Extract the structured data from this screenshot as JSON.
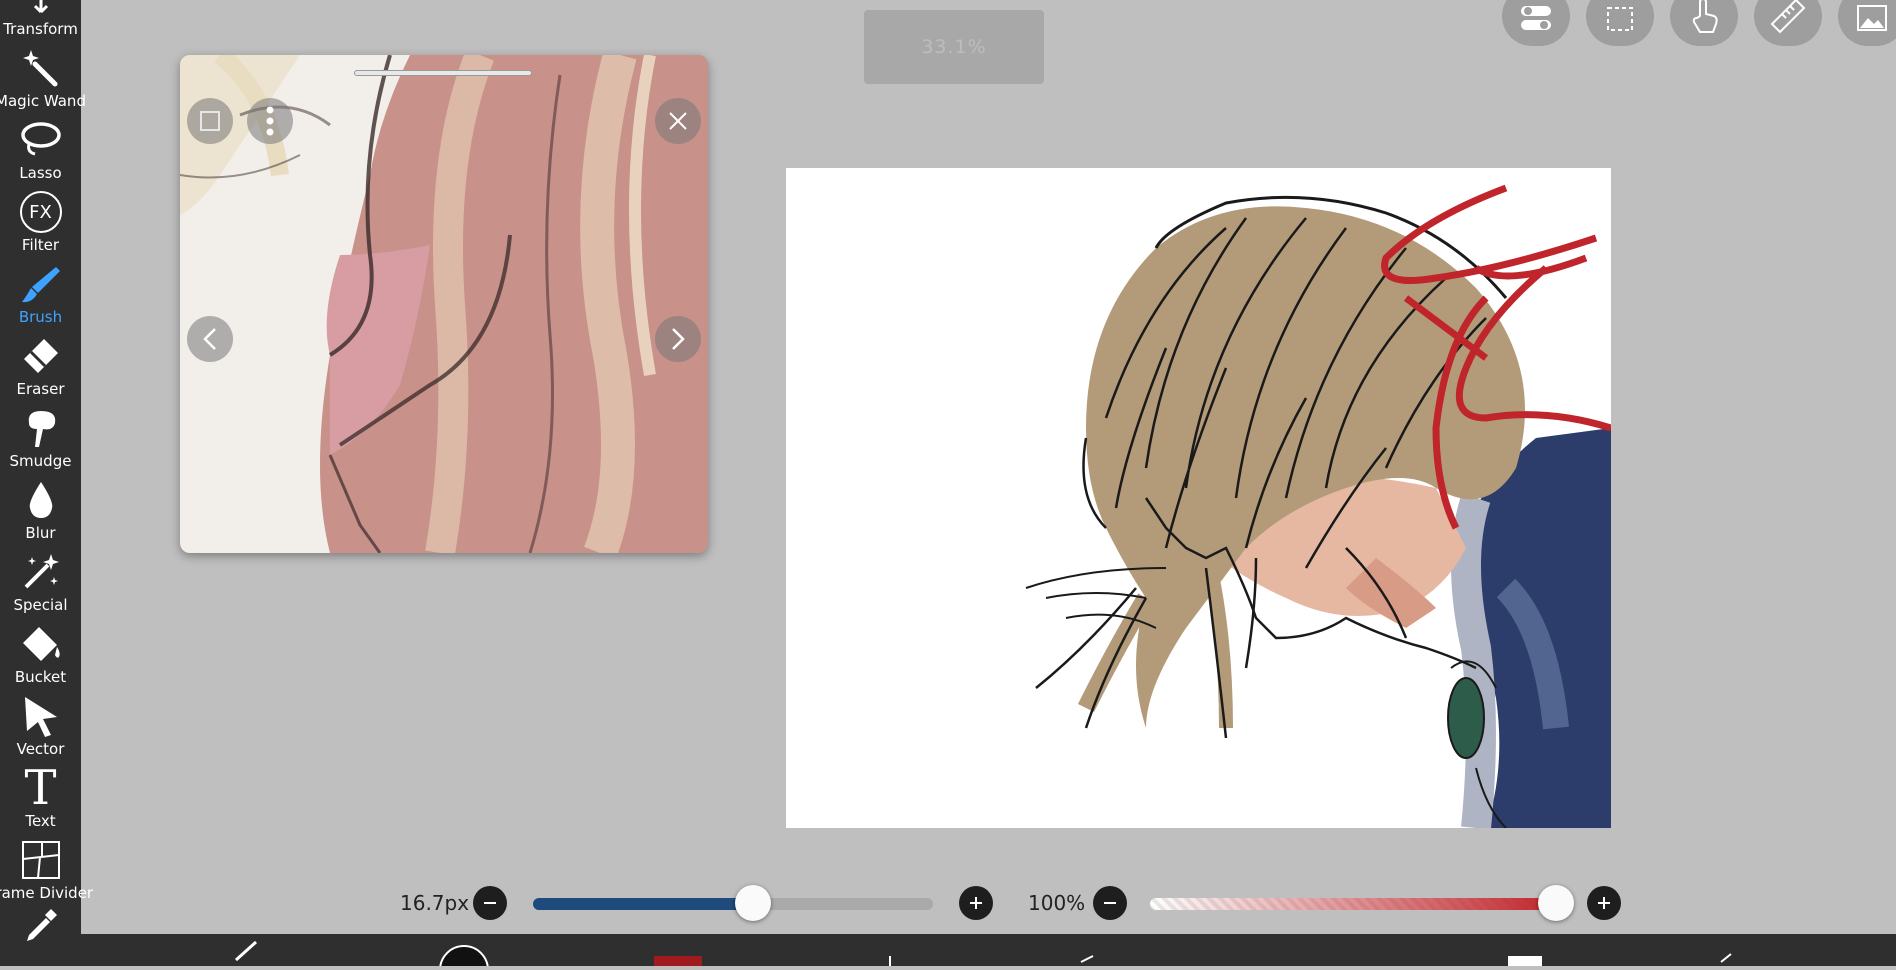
{
  "toolbar": {
    "tools": [
      {
        "id": "transform",
        "label": "Transform",
        "icon": "transform-icon"
      },
      {
        "id": "magic-wand",
        "label": "Magic Wand",
        "icon": "magic-wand-icon"
      },
      {
        "id": "lasso",
        "label": "Lasso",
        "icon": "lasso-icon"
      },
      {
        "id": "filter",
        "label": "Filter",
        "icon": "fx-icon",
        "icon_text": "FX"
      },
      {
        "id": "brush",
        "label": "Brush",
        "icon": "brush-icon",
        "active": true
      },
      {
        "id": "eraser",
        "label": "Eraser",
        "icon": "eraser-icon"
      },
      {
        "id": "smudge",
        "label": "Smudge",
        "icon": "smudge-icon"
      },
      {
        "id": "blur",
        "label": "Blur",
        "icon": "blur-drop-icon"
      },
      {
        "id": "special",
        "label": "Special",
        "icon": "special-sparkle-icon"
      },
      {
        "id": "bucket",
        "label": "Bucket",
        "icon": "bucket-icon"
      },
      {
        "id": "vector",
        "label": "Vector",
        "icon": "vector-arrow-icon"
      },
      {
        "id": "text",
        "label": "Text",
        "icon": "text-icon",
        "icon_text": "T"
      },
      {
        "id": "frame-divider",
        "label": "Frame Divider",
        "icon": "frame-divider-icon"
      }
    ],
    "active_color": "#3ea3ff"
  },
  "zoom": {
    "label": "33.1%"
  },
  "brush_size": {
    "label": "16.7px",
    "fraction": 0.55,
    "color": "#1f4a7c"
  },
  "opacity": {
    "label": "100%",
    "fraction": 1.0,
    "color": "#c0262c"
  },
  "colors": {
    "primary": "#a01b1f",
    "ui_dark": "#2f2f2f",
    "background": "#bfbfbf"
  },
  "top_buttons": [
    "toggle-icon",
    "selection-icon",
    "hand-icon",
    "ruler-icon",
    "image-icon"
  ]
}
